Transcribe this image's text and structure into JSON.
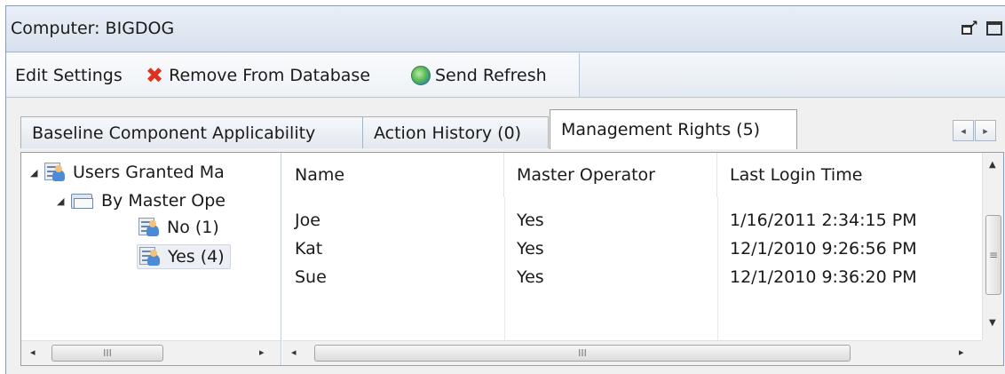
{
  "window": {
    "title": "Computer: BIGDOG"
  },
  "toolbar": {
    "edit_label": "Edit Settings",
    "remove_label": "Remove From Database",
    "refresh_label": "Send Refresh"
  },
  "tabs": [
    {
      "label": "Baseline Component Applicability",
      "active": false
    },
    {
      "label": "Action History (0)",
      "active": false
    },
    {
      "label": "Management Rights (5)",
      "active": true
    }
  ],
  "tree": {
    "root_label": "Users Granted Ma",
    "group_label": "By Master Ope",
    "items": [
      {
        "label": "No (1)",
        "selected": false
      },
      {
        "label": "Yes (4)",
        "selected": true
      }
    ]
  },
  "grid": {
    "columns": [
      "Name",
      "Master Operator",
      "Last Login Time"
    ],
    "rows": [
      {
        "name": "Joe",
        "master_operator": "Yes",
        "last_login": "1/16/2011 2:34:15 PM"
      },
      {
        "name": "Kat",
        "master_operator": "Yes",
        "last_login": "12/1/2010 9:26:56 PM"
      },
      {
        "name": "Sue",
        "master_operator": "Yes",
        "last_login": "12/1/2010 9:36:20 PM"
      }
    ]
  },
  "scroll_thumb_glyph": "III",
  "vscroll_thumb_glyph": "≡",
  "colors": {
    "remove_icon": "#e0301e",
    "title_bar": "#d7e1ee",
    "panel_border": "#8c9fb5"
  }
}
